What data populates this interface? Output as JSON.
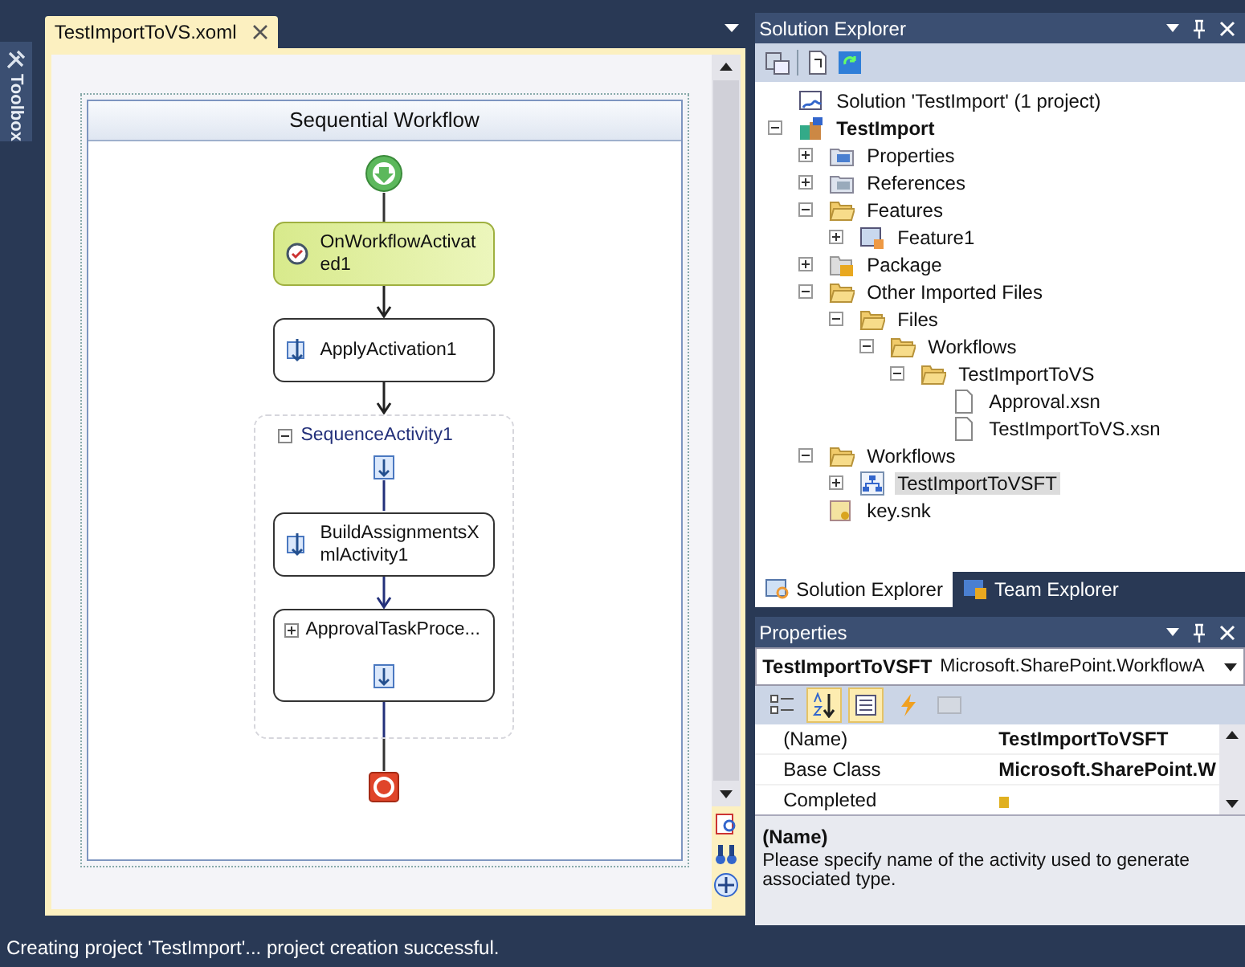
{
  "toolbox": {
    "label": "Toolbox"
  },
  "document": {
    "tab": {
      "label": "TestImportToVS.xoml",
      "selected": true
    },
    "workflow": {
      "title": "Sequential Workflow",
      "activities": [
        {
          "kind": "event",
          "label": "OnWorkflowActivated1"
        },
        {
          "kind": "activity",
          "label": "ApplyActivation1"
        },
        {
          "kind": "sequence",
          "label": "SequenceActivity1",
          "expanded": true,
          "children": [
            {
              "kind": "activity",
              "label": "BuildAssignmentsXmlActivity1"
            },
            {
              "kind": "composite",
              "label": "ApprovalTaskProce...",
              "expanded": false
            }
          ]
        }
      ]
    }
  },
  "solution_explorer": {
    "title": "Solution Explorer",
    "tree": [
      {
        "label": "Solution 'TestImport' (1 project)",
        "kind": "solution",
        "selected": false
      },
      {
        "label": "TestImport",
        "kind": "project",
        "bold": true,
        "selected": false,
        "expanded": true,
        "children": [
          {
            "label": "Properties",
            "kind": "properties",
            "selected": false,
            "expanded": false
          },
          {
            "label": "References",
            "kind": "references",
            "selected": false,
            "expanded": false
          },
          {
            "label": "Features",
            "kind": "folder",
            "selected": false,
            "expanded": true,
            "children": [
              {
                "label": "Feature1",
                "kind": "feature",
                "selected": false,
                "expanded": false
              }
            ]
          },
          {
            "label": "Package",
            "kind": "package",
            "selected": false,
            "expanded": false
          },
          {
            "label": "Other Imported Files",
            "kind": "folder",
            "selected": false,
            "expanded": true,
            "children": [
              {
                "label": "Files",
                "kind": "folder",
                "selected": false,
                "expanded": true,
                "children": [
                  {
                    "label": "Workflows",
                    "kind": "folder",
                    "selected": false,
                    "expanded": true,
                    "children": [
                      {
                        "label": "TestImportToVS",
                        "kind": "folder",
                        "selected": false,
                        "expanded": true,
                        "children": [
                          {
                            "label": "Approval.xsn",
                            "kind": "file",
                            "selected": false
                          },
                          {
                            "label": "TestImportToVS.xsn",
                            "kind": "file",
                            "selected": false
                          }
                        ]
                      }
                    ]
                  }
                ]
              }
            ]
          },
          {
            "label": "Workflows",
            "kind": "folder",
            "selected": false,
            "expanded": true,
            "children": [
              {
                "label": "TestImportToVSFT",
                "kind": "workflow",
                "selected": true,
                "expanded": false
              }
            ]
          },
          {
            "label": "key.snk",
            "kind": "key",
            "selected": false
          }
        ]
      }
    ],
    "tabs": [
      {
        "label": "Solution Explorer",
        "selected": true
      },
      {
        "label": "Team Explorer",
        "selected": false
      }
    ]
  },
  "properties": {
    "title": "Properties",
    "object_name": "TestImportToVSFT",
    "object_type": "Microsoft.SharePoint.WorkflowA",
    "toolbar": [
      {
        "kind": "categorized",
        "selected": false,
        "disabled": false
      },
      {
        "kind": "alphabetical",
        "selected": true,
        "disabled": false
      },
      {
        "kind": "properties",
        "selected": true,
        "disabled": false
      },
      {
        "kind": "events",
        "selected": false,
        "disabled": false
      },
      {
        "kind": "pages",
        "selected": false,
        "disabled": true
      }
    ],
    "rows": [
      {
        "name": "(Name)",
        "value": "TestImportToVSFT",
        "selected": false
      },
      {
        "name": "Base Class",
        "value": "Microsoft.SharePoint.W",
        "selected": false
      },
      {
        "name": "Completed",
        "selected": false
      }
    ],
    "description_title": "(Name)",
    "description": "Please specify name of the activity used to generate associated type."
  },
  "status_bar": "Creating project 'TestImport'... project creation successful."
}
